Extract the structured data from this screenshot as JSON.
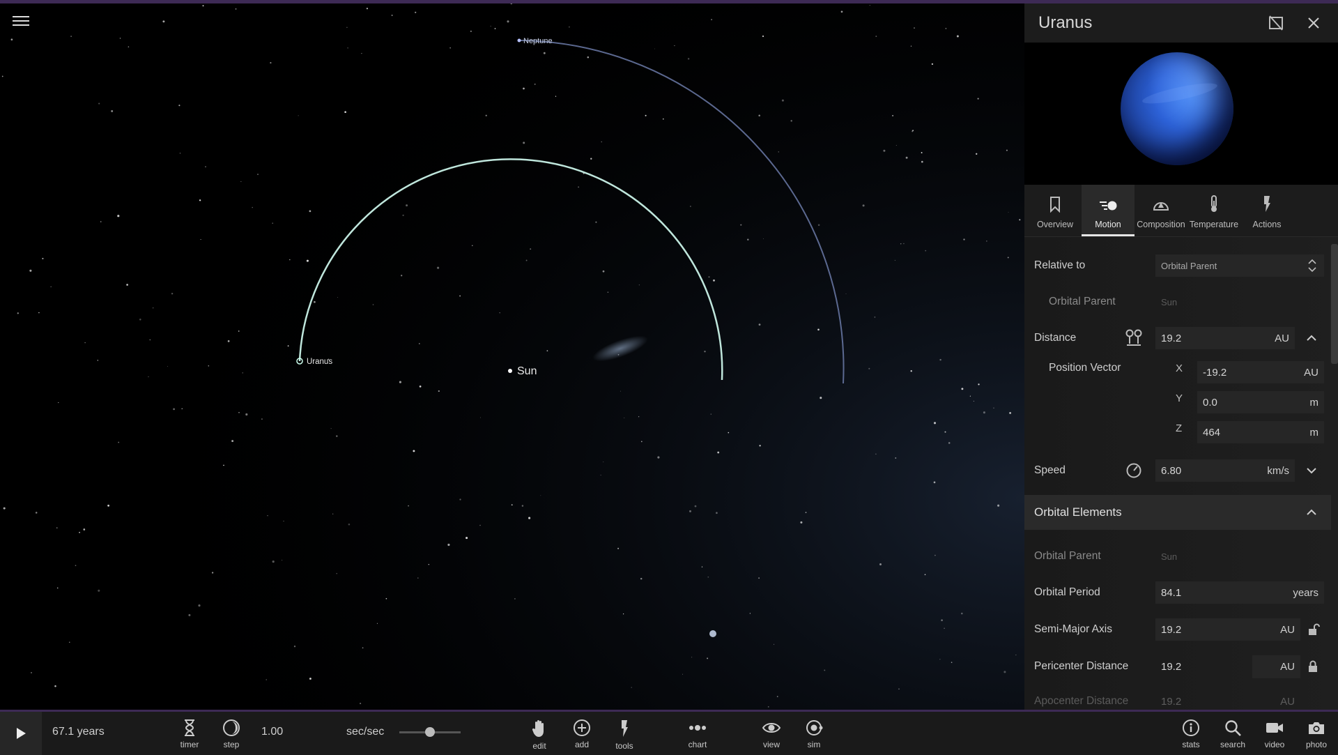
{
  "scene": {
    "neptune_label": "Neptune",
    "uranus_label": "Uranus",
    "sun_label": "Sun"
  },
  "panel": {
    "title": "Uranus",
    "tabs": [
      {
        "label": "Overview",
        "icon": "bookmark-icon"
      },
      {
        "label": "Motion",
        "icon": "motion-icon",
        "active": true
      },
      {
        "label": "Composition",
        "icon": "composition-icon"
      },
      {
        "label": "Temperature",
        "icon": "thermometer-icon"
      },
      {
        "label": "Actions",
        "icon": "actions-icon"
      }
    ],
    "relative_to": {
      "label": "Relative to",
      "value": "Orbital Parent"
    },
    "orbital_parent_top": {
      "label": "Orbital Parent",
      "value": "Sun"
    },
    "distance": {
      "label": "Distance",
      "value": "19.2",
      "unit": "AU"
    },
    "position_vector": {
      "label": "Position Vector",
      "x": {
        "axis": "X",
        "value": "-19.2",
        "unit": "AU"
      },
      "y": {
        "axis": "Y",
        "value": "0.0",
        "unit": "m"
      },
      "z": {
        "axis": "Z",
        "value": "464",
        "unit": "m"
      }
    },
    "speed": {
      "label": "Speed",
      "value": "6.80",
      "unit": "km/s"
    },
    "orbital_elements": {
      "title": "Orbital Elements",
      "orbital_parent": {
        "label": "Orbital Parent",
        "value": "Sun"
      },
      "orbital_period": {
        "label": "Orbital Period",
        "value": "84.1",
        "unit": "years"
      },
      "semi_major_axis": {
        "label": "Semi-Major Axis",
        "value": "19.2",
        "unit": "AU"
      },
      "pericenter_distance": {
        "label": "Pericenter Distance",
        "value": "19.2",
        "unit": "AU"
      },
      "apocenter_distance": {
        "label": "Apocenter Distance",
        "value": "19.2",
        "unit": "AU"
      }
    }
  },
  "bottom": {
    "elapsed": "67.1 years",
    "rate_value": "1.00",
    "rate_unit": "sec/sec",
    "rate_slider_fraction": 0.5,
    "tools": [
      {
        "label": "timer",
        "icon": "hourglass-icon"
      },
      {
        "label": "step",
        "icon": "step-icon"
      },
      {
        "label": "edit",
        "icon": "hand-icon"
      },
      {
        "label": "add",
        "icon": "add-icon"
      },
      {
        "label": "tools",
        "icon": "tools-icon"
      },
      {
        "label": "chart",
        "icon": "chart-icon"
      },
      {
        "label": "view",
        "icon": "eye-icon"
      },
      {
        "label": "sim",
        "icon": "sim-icon"
      },
      {
        "label": "stats",
        "icon": "info-icon"
      },
      {
        "label": "search",
        "icon": "search-icon"
      },
      {
        "label": "video",
        "icon": "video-icon"
      },
      {
        "label": "photo",
        "icon": "camera-icon"
      }
    ]
  }
}
